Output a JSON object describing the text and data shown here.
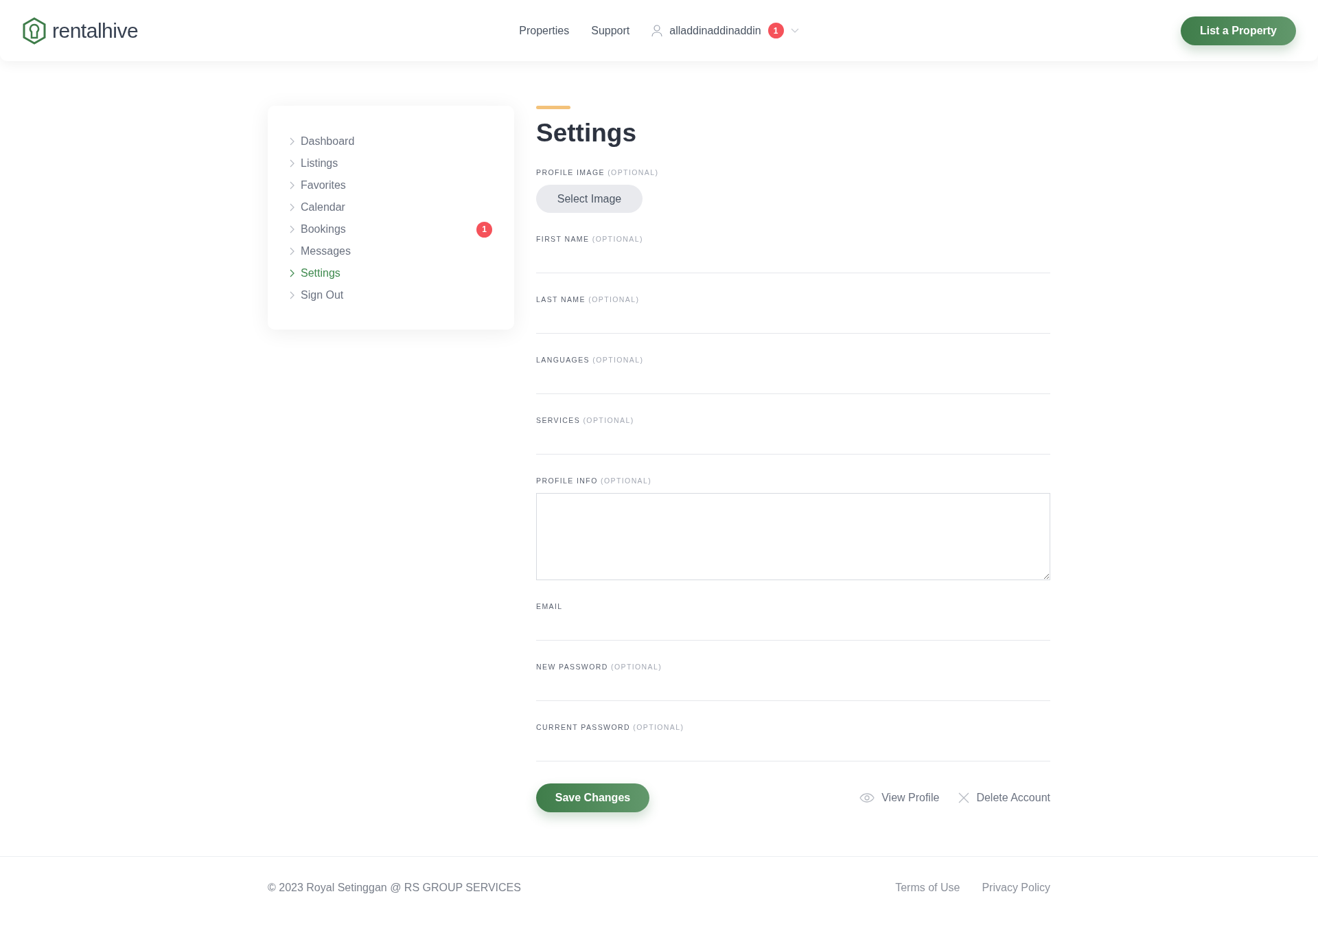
{
  "header": {
    "brand": "rentalhive",
    "nav": [
      "Properties",
      "Support"
    ],
    "user": {
      "name": "alladdinaddinaddin",
      "badge": "1"
    },
    "cta": "List a Property"
  },
  "sidebar": {
    "items": [
      {
        "label": "Dashboard",
        "selected": false
      },
      {
        "label": "Listings",
        "selected": false
      },
      {
        "label": "Favorites",
        "selected": false
      },
      {
        "label": "Calendar",
        "selected": false
      },
      {
        "label": "Bookings",
        "selected": false,
        "badge": "1"
      },
      {
        "label": "Messages",
        "selected": false
      },
      {
        "label": "Settings",
        "selected": true
      },
      {
        "label": "Sign Out",
        "selected": false
      }
    ]
  },
  "main": {
    "title": "Settings",
    "fields": [
      {
        "kind": "image",
        "label": "PROFILE IMAGE",
        "note": "(OPTIONAL)",
        "button": "Select Image"
      },
      {
        "kind": "input",
        "label": "FIRST NAME",
        "note": "(OPTIONAL)"
      },
      {
        "kind": "input",
        "label": "LAST NAME",
        "note": "(OPTIONAL)"
      },
      {
        "kind": "input",
        "label": "LANGUAGES",
        "note": "(OPTIONAL)"
      },
      {
        "kind": "input",
        "label": "SERVICES",
        "note": "(OPTIONAL)"
      },
      {
        "kind": "textarea",
        "label": "PROFILE INFO",
        "note": "(OPTIONAL)"
      },
      {
        "kind": "input",
        "label": "EMAIL"
      },
      {
        "kind": "input",
        "label": "NEW PASSWORD",
        "note": "(OPTIONAL)"
      },
      {
        "kind": "input",
        "label": "CURRENT PASSWORD",
        "note": "(OPTIONAL)"
      }
    ],
    "save": "Save Changes",
    "links": [
      {
        "kind": "view",
        "label": "View Profile"
      },
      {
        "kind": "delete",
        "label": "Delete Account"
      }
    ]
  },
  "footer": {
    "copyright": "© 2023 Royal Setinggan @ RS GROUP SERVICES",
    "links": [
      "Terms of Use",
      "Privacy Policy"
    ]
  }
}
